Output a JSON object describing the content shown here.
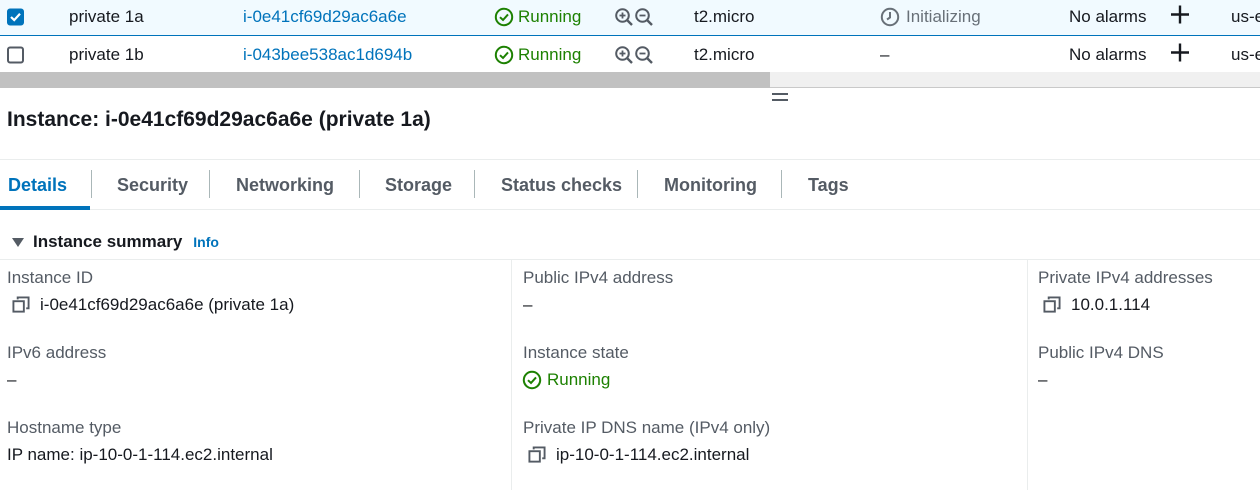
{
  "table": {
    "rows": [
      {
        "checked": true,
        "name": "private 1a",
        "instance_id": "i-0e41cf69d29ac6a6e",
        "state": "Running",
        "type": "t2.micro",
        "status_check": "Initializing",
        "alarms": "No alarms",
        "az": "us-e"
      },
      {
        "checked": false,
        "name": "private 1b",
        "instance_id": "i-043bee538ac1d694b",
        "state": "Running",
        "type": "t2.micro",
        "status_check": "–",
        "alarms": "No alarms",
        "az": "us-e"
      }
    ]
  },
  "detail": {
    "title": "Instance: i-0e41cf69d29ac6a6e (private 1a)",
    "tabs": [
      "Details",
      "Security",
      "Networking",
      "Storage",
      "Status checks",
      "Monitoring",
      "Tags"
    ],
    "active_tab": "Details",
    "section": {
      "title": "Instance summary",
      "info": "Info"
    },
    "fields": {
      "instance_id_label": "Instance ID",
      "instance_id_value": "i-0e41cf69d29ac6a6e (private 1a)",
      "public_ipv4_label": "Public IPv4 address",
      "public_ipv4_value": "–",
      "private_ipv4_label": "Private IPv4 addresses",
      "private_ipv4_value": "10.0.1.114",
      "ipv6_label": "IPv6 address",
      "ipv6_value": "–",
      "instance_state_label": "Instance state",
      "instance_state_value": "Running",
      "public_dns_label": "Public IPv4 DNS",
      "public_dns_value": "–",
      "hostname_type_label": "Hostname type",
      "hostname_type_value": "IP name: ip-10-0-1-114.ec2.internal",
      "private_dns_label": "Private IP DNS name (IPv4 only)",
      "private_dns_value": "ip-10-0-1-114.ec2.internal"
    }
  },
  "icons": {
    "running": "check-circle-icon",
    "initializing": "clock-icon",
    "zoom": "zoom-in-out-icon",
    "add": "plus-icon",
    "copy": "copy-icon"
  },
  "colors": {
    "accent": "#0073bb",
    "success": "#1d8102",
    "selected_row_bg": "#f1faff"
  }
}
